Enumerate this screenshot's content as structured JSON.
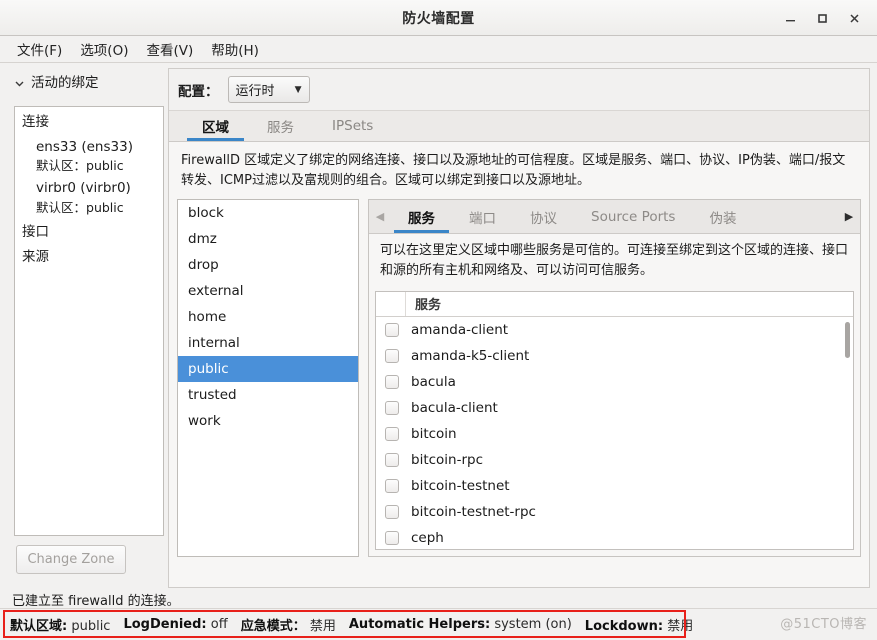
{
  "window": {
    "title": "防火墙配置",
    "controls": [
      {
        "name": "minimize",
        "glyph": "—"
      },
      {
        "name": "maximize",
        "glyph": "□"
      },
      {
        "name": "close",
        "glyph": "✕"
      }
    ]
  },
  "menubar": {
    "items": [
      "文件(F)",
      "选项(O)",
      "查看(V)",
      "帮助(H)"
    ]
  },
  "left_pane": {
    "expander_label": "活动的绑定",
    "tree": {
      "connections_label": "连接",
      "connections": [
        {
          "name": "ens33 (ens33)",
          "zone_label": "默认区：",
          "zone_value": "public"
        },
        {
          "name": "virbr0 (virbr0)",
          "zone_label": "默认区：",
          "zone_value": "public"
        }
      ],
      "interfaces_label": "接口",
      "sources_label": "来源"
    },
    "change_zone_button": "Change Zone"
  },
  "right_pane": {
    "config_label": "配置：",
    "config_value": "运行时",
    "tabs": [
      {
        "label": "区域",
        "active": true
      },
      {
        "label": "服务",
        "active": false
      },
      {
        "label": "IPSets",
        "active": false
      }
    ],
    "description": "FirewallD 区域定义了绑定的网络连接、接口以及源地址的可信程度。区域是服务、端口、协议、IP伪装、端口/报文转发、ICMP过滤以及富规则的组合。区域可以绑定到接口以及源地址。",
    "zones": [
      {
        "label": "block",
        "selected": false
      },
      {
        "label": "dmz",
        "selected": false
      },
      {
        "label": "drop",
        "selected": false
      },
      {
        "label": "external",
        "selected": false
      },
      {
        "label": "home",
        "selected": false
      },
      {
        "label": "internal",
        "selected": false
      },
      {
        "label": "public",
        "selected": true
      },
      {
        "label": "trusted",
        "selected": false
      },
      {
        "label": "work",
        "selected": false
      }
    ],
    "inner_tabs": {
      "scroll_left": "◀",
      "scroll_right": "▶",
      "items": [
        {
          "label": "服务",
          "active": true
        },
        {
          "label": "端口",
          "active": false
        },
        {
          "label": "协议",
          "active": false
        },
        {
          "label": "Source Ports",
          "active": false
        },
        {
          "label": "伪装",
          "active": false
        }
      ]
    },
    "inner_description": "可以在这里定义区域中哪些服务是可信的。可连接至绑定到这个区域的连接、接口和源的所有主机和网络及、可以访问可信服务。",
    "service_table": {
      "header": "服务",
      "rows": [
        {
          "name": "amanda-client",
          "checked": false
        },
        {
          "name": "amanda-k5-client",
          "checked": false
        },
        {
          "name": "bacula",
          "checked": false
        },
        {
          "name": "bacula-client",
          "checked": false
        },
        {
          "name": "bitcoin",
          "checked": false
        },
        {
          "name": "bitcoin-rpc",
          "checked": false
        },
        {
          "name": "bitcoin-testnet",
          "checked": false
        },
        {
          "name": "bitcoin-testnet-rpc",
          "checked": false
        },
        {
          "name": "ceph",
          "checked": false
        }
      ]
    }
  },
  "status": {
    "connection_message": "已建立至 firewalld 的连接。",
    "items": [
      {
        "label": "默认区域:",
        "value": "public"
      },
      {
        "label": "LogDenied:",
        "value": "off"
      },
      {
        "label": "应急模式：",
        "value": "禁用"
      },
      {
        "label": "Automatic Helpers:",
        "value": "system (on)"
      },
      {
        "label": "Lockdown:",
        "value": "禁用"
      }
    ],
    "highlight_color": "#e8201a"
  },
  "watermark": "@51CTO博客",
  "colors": {
    "selection_blue": "#4a90d9",
    "tab_underline": "#3b86c8",
    "annotation_red": "#e8201a"
  }
}
